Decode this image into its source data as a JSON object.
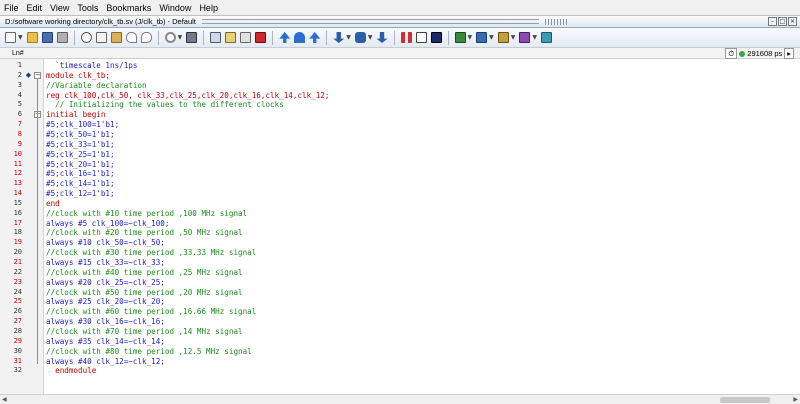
{
  "menu": [
    "File",
    "Edit",
    "View",
    "Tools",
    "Bookmarks",
    "Window",
    "Help"
  ],
  "window": {
    "title": "D:/software working directory/clk_tb.sv (J/clk_tb) - Default",
    "controls": [
      "–",
      "□",
      "×"
    ]
  },
  "toolbar": {
    "icons": [
      "new-file-icon",
      "open-folder-icon",
      "save-icon",
      "print-icon",
      "cut-icon",
      "copy-icon",
      "paste-icon",
      "undo-icon",
      "redo-icon",
      "no-entry-icon",
      "compile-icon",
      "find-icon",
      "bookmark-icon",
      "step-icon",
      "step-over-icon",
      "step-out-icon",
      "restart-icon",
      "break-icon",
      "wave-add-icon",
      "wave-dataflow-icon",
      "wave-list-icon"
    ]
  },
  "gutter_header": {
    "label": "Ln#"
  },
  "status": {
    "value": "291608",
    "unit": "ps"
  },
  "colors": {
    "keyword": "#c80000",
    "comment": "#1a8c1a",
    "normal": "#1e1ec8",
    "line_red": "#cc0000"
  },
  "code_lines": [
    {
      "n": "1",
      "text": "  `timescale 1ns/1ps",
      "kind": "normal",
      "ln_red": false
    },
    {
      "n": "2",
      "text": "module clk_tb;",
      "kind": "keyword",
      "ln_red": false
    },
    {
      "n": "3",
      "text": "//Variable declaration",
      "kind": "comment",
      "ln_red": false
    },
    {
      "n": "4",
      "text": "reg clk_100,clk_50, clk_33,clk_25,clk_20,clk_16,clk_14,clk_12;",
      "kind": "keyword",
      "ln_red": false
    },
    {
      "n": "5",
      "text": "  // Initializing the values to the different clocks",
      "kind": "comment",
      "ln_red": false
    },
    {
      "n": "6",
      "text": "initial begin",
      "kind": "keyword",
      "ln_red": false
    },
    {
      "n": "7",
      "text": "#5;clk_100=1'b1;",
      "kind": "normal",
      "ln_red": true
    },
    {
      "n": "8",
      "text": "#5;clk_50=1'b1;",
      "kind": "normal",
      "ln_red": true
    },
    {
      "n": "9",
      "text": "#5;clk_33=1'b1;",
      "kind": "normal",
      "ln_red": true
    },
    {
      "n": "10",
      "text": "#5;clk_25=1'b1;",
      "kind": "normal",
      "ln_red": true
    },
    {
      "n": "11",
      "text": "#5;clk_20=1'b1;",
      "kind": "normal",
      "ln_red": true
    },
    {
      "n": "12",
      "text": "#5;clk_16=1'b1;",
      "kind": "normal",
      "ln_red": true
    },
    {
      "n": "13",
      "text": "#5;clk_14=1'b1;",
      "kind": "normal",
      "ln_red": true
    },
    {
      "n": "14",
      "text": "#5;clk_12=1'b1;",
      "kind": "normal",
      "ln_red": true
    },
    {
      "n": "15",
      "text": "end",
      "kind": "keyword",
      "ln_red": false
    },
    {
      "n": "16",
      "text": "//clock with #10 time period ,100 MHz signal",
      "kind": "comment",
      "ln_red": false
    },
    {
      "n": "17",
      "text": "always #5 clk_100=~clk_100;",
      "kind": "normal",
      "ln_red": true
    },
    {
      "n": "18",
      "text": "//clock with #20 time period ,50 MHz signal",
      "kind": "comment",
      "ln_red": false
    },
    {
      "n": "19",
      "text": "always #10 clk_50=~clk_50;",
      "kind": "normal",
      "ln_red": true
    },
    {
      "n": "20",
      "text": "//clock with #30 time period ,33.33 MHz signal",
      "kind": "comment",
      "ln_red": false
    },
    {
      "n": "21",
      "text": "always #15 clk_33=~clk_33;",
      "kind": "normal",
      "ln_red": true
    },
    {
      "n": "22",
      "text": "//clock with #40 time period ,25 MHz signal",
      "kind": "comment",
      "ln_red": false
    },
    {
      "n": "23",
      "text": "always #20 clk_25=~clk_25;",
      "kind": "normal",
      "ln_red": true
    },
    {
      "n": "24",
      "text": "//clock with #50 time period ,20 MHz signal",
      "kind": "comment",
      "ln_red": false
    },
    {
      "n": "25",
      "text": "always #25 clk_20=~clk_20;",
      "kind": "normal",
      "ln_red": true
    },
    {
      "n": "26",
      "text": "//clock with #60 time period ,16.66 MHz signal",
      "kind": "comment",
      "ln_red": false
    },
    {
      "n": "27",
      "text": "always #30 clk_16=~clk_16;",
      "kind": "normal",
      "ln_red": true
    },
    {
      "n": "28",
      "text": "//clock with #70 time period ,14 MHz signal",
      "kind": "comment",
      "ln_red": false
    },
    {
      "n": "29",
      "text": "always #35 clk_14=~clk_14;",
      "kind": "normal",
      "ln_red": true
    },
    {
      "n": "30",
      "text": "//clock with #80 time period ,12.5 MHz signal",
      "kind": "comment",
      "ln_red": false
    },
    {
      "n": "31",
      "text": "always #40 clk_12=~clk_12;",
      "kind": "normal",
      "ln_red": true
    },
    {
      "n": "32",
      "text": "  endmodule",
      "kind": "keyword",
      "ln_red": false
    }
  ]
}
